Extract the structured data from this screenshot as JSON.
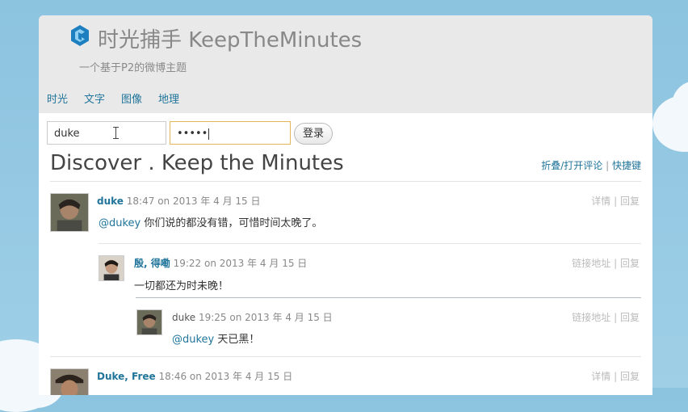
{
  "site": {
    "title": "时光捕手 KeepTheMinutes",
    "description": "一个基于P2的微博主题"
  },
  "nav": {
    "items": [
      "时光",
      "文字",
      "图像",
      "地理"
    ]
  },
  "login": {
    "username": "duke",
    "password_masked": "•••••",
    "button": "登录"
  },
  "main": {
    "title": "Discover . Keep the Minutes",
    "toggle_link": "折叠/打开评论",
    "separator": "|",
    "shortcut_link": "快捷键"
  },
  "posts": [
    {
      "author": "duke",
      "time": "18:47",
      "date": "on 2013 年 4 月 15 日",
      "actions": [
        "详情",
        "回复"
      ],
      "mention": "@dukey",
      "text": " 你们说的都没有错，可惜时间太晚了。"
    },
    {
      "author": "殷, 得嘞",
      "time": "19:22",
      "date": "on 2013 年 4 月 15 日",
      "actions": [
        "链接地址",
        "回复"
      ],
      "mention": "",
      "text": "一切都还为时未晚！"
    },
    {
      "author": "duke",
      "time": "19:25",
      "date": "on 2013 年 4 月 15 日",
      "actions": [
        "链接地址",
        "回复"
      ],
      "mention": "@dukey",
      "text": " 天已黑！"
    },
    {
      "author": "Duke, Free",
      "time": "18:46",
      "date": "on 2013 年 4 月 15 日",
      "actions": [
        "详情",
        "回复"
      ]
    }
  ],
  "colors": {
    "link": "#21759b",
    "header_bg": "#e9e9e9",
    "sky": "#8cc3df"
  }
}
